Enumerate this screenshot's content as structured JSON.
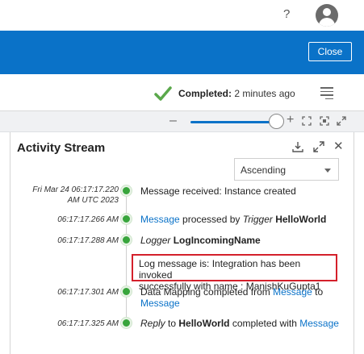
{
  "header": {
    "help_label": "?",
    "avatar_icon": "user-avatar-icon"
  },
  "toolbar": {
    "close_label": "Close"
  },
  "status": {
    "state_label": "Completed:",
    "state_value": "2 minutes ago",
    "check_color": "#5aa84b"
  },
  "zoom": {
    "minus": "–",
    "plus": "+"
  },
  "panel": {
    "title": "Activity Stream",
    "sort": {
      "selected": "Ascending"
    }
  },
  "events": [
    {
      "ts_line1": "Fri Mar 24 06:17:17.220",
      "ts_line2": "AM UTC 2023",
      "text": "Message received: Instance created"
    },
    {
      "ts": "06:17:17.266 AM",
      "link1": "Message",
      "mid": " processed by ",
      "italic": "Trigger",
      "bold": "HelloWorld"
    },
    {
      "ts": "06:17:17.288 AM",
      "italic": "Logger",
      "bold": "LogIncomingName",
      "log_line1": "Log message is: Integration has been invoked",
      "log_line2": "successfully with name : ManishKuGupta1"
    },
    {
      "ts": "06:17:17.301 AM",
      "pre": "Data Mapping completed from ",
      "link1": "Message",
      "post": " to",
      "link2": "Message"
    },
    {
      "ts": "06:17:17.325 AM",
      "italic": "Reply",
      "mid": " to ",
      "bold": "HelloWorld",
      "post": " completed with ",
      "link1": "Message"
    }
  ],
  "colors": {
    "brand_blue": "#0a72c8",
    "success_green": "#38a53c",
    "highlight_red": "#d4202b"
  }
}
